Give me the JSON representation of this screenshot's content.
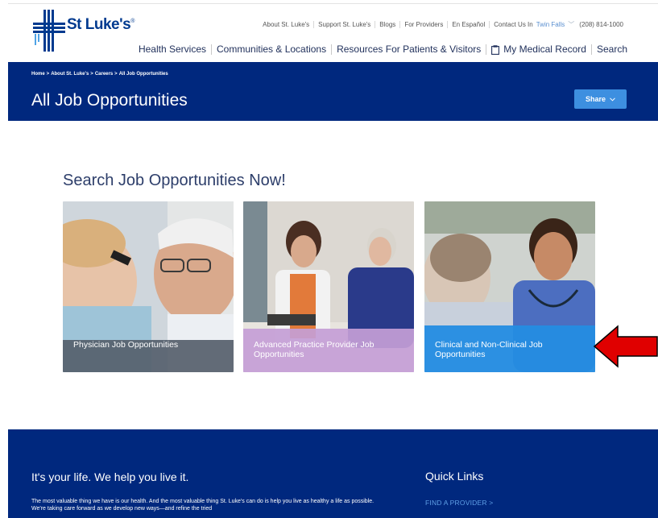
{
  "brand": {
    "name": "St Luke's",
    "mark": "®"
  },
  "utility_nav": {
    "items": [
      "About St. Luke's",
      "Support St. Luke's",
      "Blogs",
      "For Providers",
      "En Español",
      "Contact Us In"
    ],
    "location": "Twin Falls",
    "phone": "(208) 814-1000"
  },
  "main_nav": {
    "items": [
      "Health Services",
      "Communities & Locations",
      "Resources For Patients & Visitors",
      "My Medical Record",
      "Search"
    ]
  },
  "breadcrumb": {
    "items": [
      "Home",
      "About St. Luke's",
      "Careers",
      "All Job Opportunities"
    ],
    "separator": ">"
  },
  "page": {
    "title": "All Job Opportunities",
    "share_label": "Share",
    "section_title": "Search Job Opportunities Now!"
  },
  "cards": [
    {
      "label": "Physician Job Opportunities",
      "overlay_color": "#56606c"
    },
    {
      "label": "Advanced Practice Provider Job Opportunities",
      "overlay_color": "#c49ed6"
    },
    {
      "label": "Clinical and Non-Clinical Job Opportunities",
      "overlay_color": "#248ce2"
    }
  ],
  "footer": {
    "tagline": "It's your life. We help you live it.",
    "body": "The most valuable thing we have is our health. And the most valuable thing St. Luke's can do is help you live as healthy a life as possible. We're taking care forward as we develop new ways—and refine the tried",
    "quick_links_title": "Quick Links",
    "quick_links": [
      "FIND A PROVIDER >"
    ]
  },
  "colors": {
    "brand_blue": "#00287e",
    "accent_blue": "#3d8fe0",
    "arrow_red": "#e00000"
  },
  "icons": {
    "share": "chevron-down-icon",
    "location": "chevron-down-icon",
    "medical_record": "document-icon",
    "pointer": "red-arrow-icon"
  }
}
